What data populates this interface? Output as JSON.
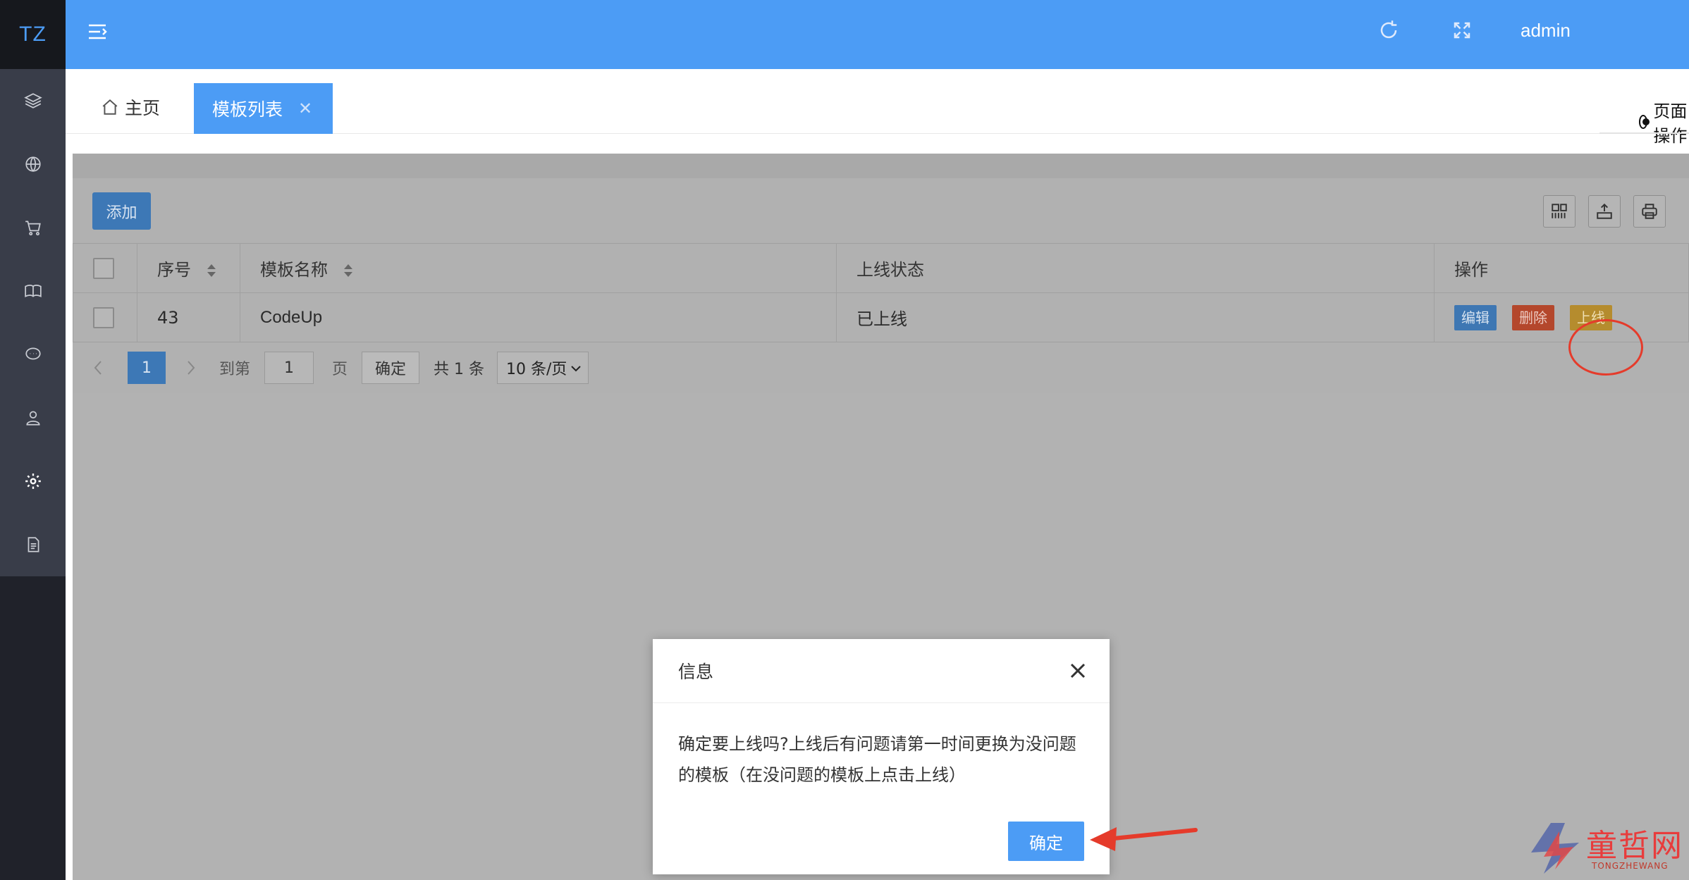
{
  "logo": "TZ",
  "header": {
    "user": "admin"
  },
  "tabs": {
    "home": "主页",
    "active": "模板列表",
    "close": "✕",
    "page_ops": "页面操作"
  },
  "toolbar": {
    "add": "添加"
  },
  "table": {
    "columns": [
      "序号",
      "模板名称",
      "上线状态",
      "操作"
    ],
    "rows": [
      {
        "id": "43",
        "name": "CodeUp",
        "status": "已上线"
      }
    ],
    "actions": {
      "edit": "编辑",
      "delete": "删除",
      "online": "上线"
    }
  },
  "pager": {
    "current": "1",
    "goto": "到第",
    "page_input": "1",
    "page_unit": "页",
    "confirm": "确定",
    "total": "共 1 条",
    "page_size": "10 条/页"
  },
  "dialog": {
    "title": "信息",
    "message": "确定要上线吗?上线后有问题请第一时间更换为没问题的模板（在没问题的模板上点击上线）",
    "ok": "确定"
  },
  "watermark": {
    "text": "童哲网",
    "sub": "TONGZHEWANG"
  },
  "colors": {
    "primary": "#4c9cf5",
    "sidebar": "#393d49",
    "danger": "#e53b2b"
  }
}
